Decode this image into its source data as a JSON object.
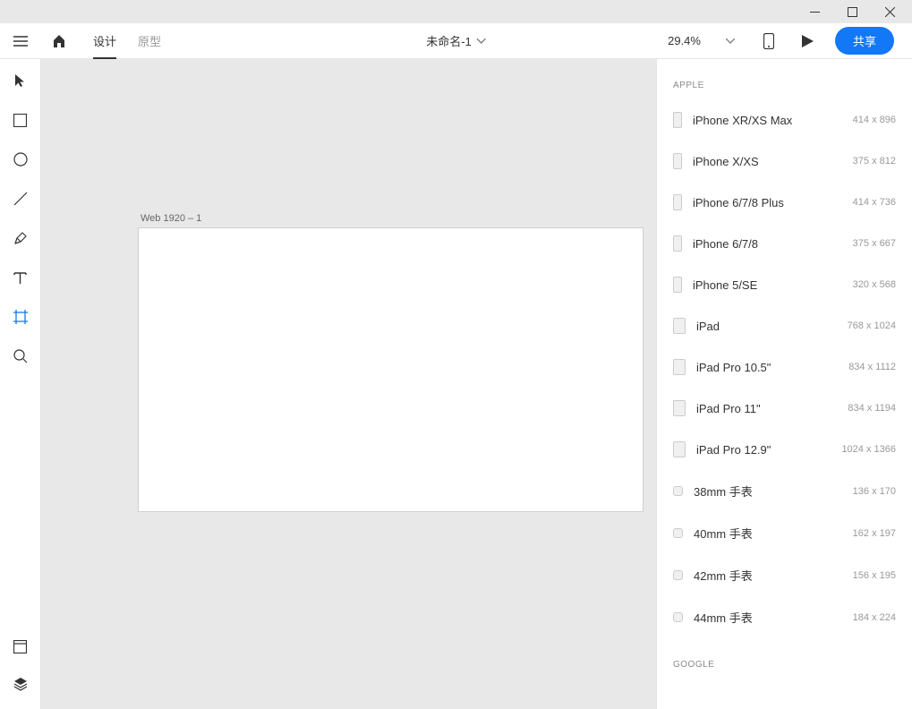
{
  "titlebar": {},
  "topbar": {
    "tabs": [
      {
        "label": "设计",
        "active": true
      },
      {
        "label": "原型",
        "active": false
      }
    ],
    "doc_title": "未命名-1",
    "zoom": "29.4%",
    "share_label": "共享"
  },
  "canvas": {
    "artboard_label": "Web 1920 – 1"
  },
  "panel": {
    "sections": [
      {
        "header": "APPLE",
        "devices": [
          {
            "name": "iPhone XR/XS Max",
            "dim": "414 x 896",
            "shape": "phone"
          },
          {
            "name": "iPhone X/XS",
            "dim": "375 x 812",
            "shape": "phone"
          },
          {
            "name": "iPhone 6/7/8 Plus",
            "dim": "414 x 736",
            "shape": "phone"
          },
          {
            "name": "iPhone 6/7/8",
            "dim": "375 x 667",
            "shape": "phone"
          },
          {
            "name": "iPhone 5/SE",
            "dim": "320 x 568",
            "shape": "phone"
          },
          {
            "name": "iPad",
            "dim": "768 x 1024",
            "shape": "tablet"
          },
          {
            "name": "iPad Pro 10.5\"",
            "dim": "834 x 1112",
            "shape": "tablet"
          },
          {
            "name": "iPad Pro 11\"",
            "dim": "834 x 1194",
            "shape": "tablet"
          },
          {
            "name": "iPad Pro 12.9\"",
            "dim": "1024 x 1366",
            "shape": "tablet"
          },
          {
            "name": "38mm 手表",
            "dim": "136 x 170",
            "shape": "watch"
          },
          {
            "name": "40mm 手表",
            "dim": "162 x 197",
            "shape": "watch"
          },
          {
            "name": "42mm 手表",
            "dim": "156 x 195",
            "shape": "watch"
          },
          {
            "name": "44mm 手表",
            "dim": "184 x 224",
            "shape": "watch"
          }
        ]
      },
      {
        "header": "GOOGLE",
        "devices": []
      }
    ]
  }
}
